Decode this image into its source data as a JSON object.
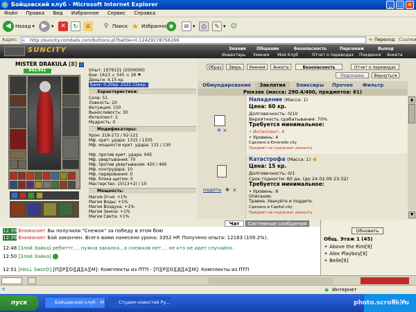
{
  "window": {
    "title": "Бойцовский клуб - Microsoft Internet Explorer"
  },
  "menu": [
    "Файл",
    "Правка",
    "Вид",
    "Избранное",
    "Сервис",
    "Справка"
  ],
  "toolbar": {
    "back": "Назад",
    "search": "Поиск",
    "favorites": "Избранное"
  },
  "address": {
    "label": "Адрес:",
    "url": "http://suncity.combats.com/buttons.pl?battle=0.12429178756166",
    "go": "Переход",
    "links": "Ссылки"
  },
  "game": {
    "logo": "SUNCITY",
    "nav_top": [
      "Знания",
      "Общение",
      "Безопасность",
      "Персонаж",
      "Выход"
    ],
    "nav_bottom": [
      "Инвентарь",
      "Умения",
      "Мой Клуб",
      "Отчет о переводах",
      "Поединки",
      "Анкета"
    ]
  },
  "character": {
    "name": "MISTER DRAKULA",
    "level": "[8]",
    "hp": "941/941",
    "exp": "Опыт: 1979131 (2000000)",
    "fights": "Бои: 1613 ⚔ 545 ⚔ 26 ⚑",
    "money": "Деньги: 4.15 кр.",
    "bank": "Банк: 0.20кр. 2522.15екр.",
    "chars_header": "Характеристики:",
    "stats": [
      "Сила: 51",
      "Ловкость: 20",
      "Интуиция: 150",
      "Выносливость: 30",
      "Интеллект: 2",
      "Мудрость: 0"
    ],
    "mods_header": "Модификаторы:",
    "mods": [
      "Урон: 218-272 / 92-121",
      "Мф. крит. удара: 1315 / 1335",
      "Мф. мощности крит. удара: 131 / 130",
      "Мф. против крит. удара: 945",
      "Мф. увертывания: 70",
      "Мф. против увертывания: 420 / 460",
      "Мф. контрудара: 10",
      "Мф. парирования: 0",
      "Мф. блока щитом: 0",
      "Мастерство: 15(13+2) / 10"
    ],
    "power_header": "Мощность:",
    "power": [
      "Магия Огня: +1%",
      "Магия Воды: +1%",
      "Магия Воздуха: +1%",
      "Магия Земли: +1%",
      "Магия Света: +1%"
    ]
  },
  "panel": {
    "top_buttons": [
      "Образ",
      "Зверь",
      "Умения",
      "Анкета"
    ],
    "security": "Безопасность",
    "report": "Отчет о переводах",
    "hint": "Подсказка",
    "back": "Вернуться",
    "tabs": [
      "Обмундирование",
      "Заклятия",
      "Эликсиры",
      "Прочее",
      "Фильтр"
    ],
    "inventory_header": "Рюкзак (масса: 290.4/400, предметов: 61)",
    "items": [
      {
        "name": "Нападение",
        "mass": "(Масса: 1)",
        "lines": [
          "Цена: 60 кр.",
          "Долговечность: 0/10",
          "Вероятность срабатывания: 70%"
        ],
        "req_header": "Требуется минимальное:",
        "reqs": [
          "• Интеллект: 4",
          "• Уровень: 4"
        ],
        "made": "Сделано в Emeralds city",
        "repair": "Предмет не подлежит ремонту"
      },
      {
        "name": "Катастрофа",
        "mass": "(Масса: 1)",
        "lines": [
          "Цена: 15 кр.",
          "Долговечность: 0/1",
          "Срок годности: 60 дн. (до 24.02.09 23:32)"
        ],
        "req_header": "Требуется минимальное:",
        "reqs": [
          "• Уровень: 8"
        ],
        "desc_header": "Описание:",
        "desc": "Травма. Увакуйте и поддите.",
        "made": "Сделано в Capital city",
        "repair": "Предмет не подлежит ремонту",
        "action": "надеть"
      }
    ]
  },
  "chat": {
    "tabs": [
      "Чат",
      "Системные сообщения"
    ],
    "lines": [
      {
        "time": "12:39",
        "who": "Внимание!",
        "text": "Вы получили \"Снежок\" за победу в этом бою"
      },
      {
        "time": "12:39",
        "who": "Внимание!",
        "text": "Бой закончен. Всего вами нанесено урона: 3352 HP. Получено опыта: 12183 (109.2%)."
      },
      {
        "time": "12:48",
        "who": "[Злой Зайка]",
        "text": "ребяттт.... нужна закалка...а снежков нет ... не кто не идет случайно.."
      },
      {
        "time": "12:50",
        "who": "[Злой Зайка]",
        "text": ""
      },
      {
        "time": "12:51",
        "who": "[HeLL SworD]",
        "text": "[П][Р][О][Д][А][М]: Комплекты из ПТП - [П][Р][О][Д][А][М]: Комплекты из ПТП"
      }
    ]
  },
  "online": {
    "refresh": "Обновить",
    "location": "Общ. Этаж 1 (45)",
    "users": [
      "Above the Rim[9]",
      "Alex Playboy[9]",
      "Belle[9]"
    ]
  },
  "status": {
    "text": "",
    "zone": "Интернет",
    "time": "12:55",
    "watermark": "photo.scrolls.ru"
  },
  "taskbar": {
    "start": "пуск",
    "tasks": [
      "Бойцовский клуб - M...",
      "Студия новостей Ру..."
    ]
  }
}
